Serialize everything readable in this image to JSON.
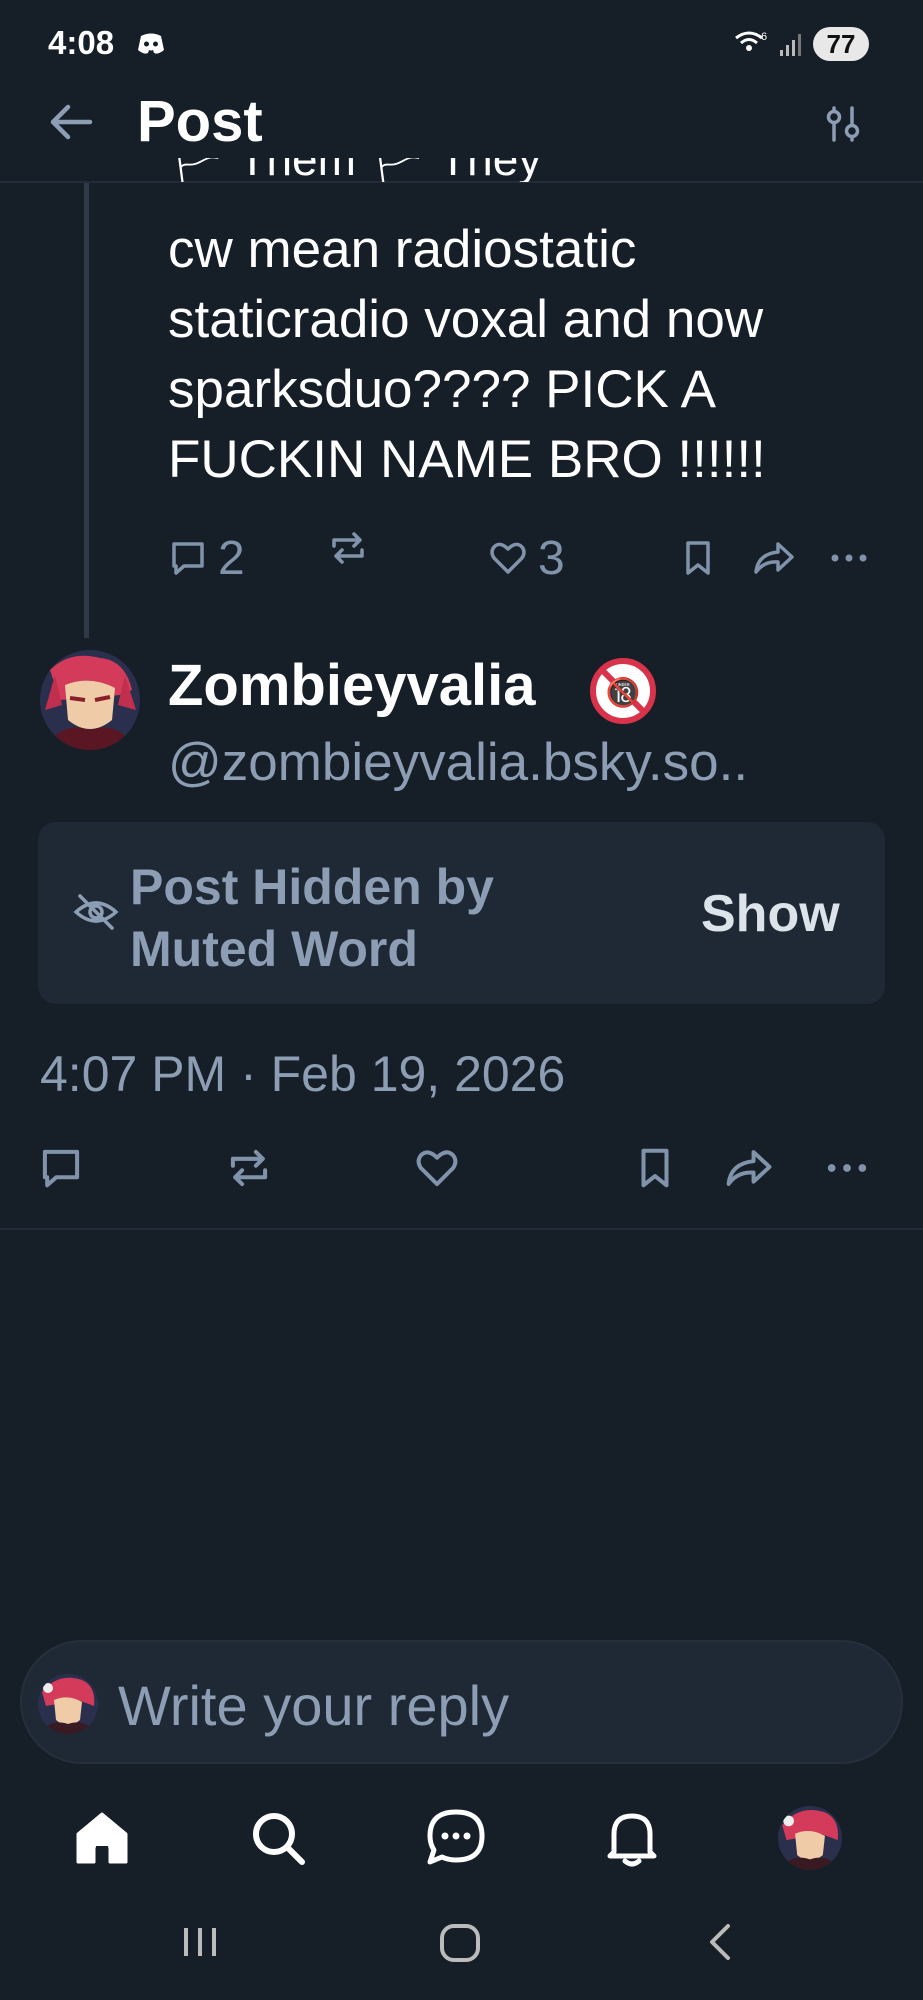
{
  "status_bar": {
    "time": "4:08",
    "battery": "77",
    "icons": [
      "discord-icon",
      "wifi-icon",
      "signal-icon"
    ]
  },
  "header": {
    "title": "Post",
    "back_icon": "back-arrow-icon",
    "filter_icon": "sliders-icon"
  },
  "parent_post": {
    "clipped_text": "🏳 Them 🏳 They",
    "text": "cw mean radiostatic\nstaticradio voxal and now\nsparksduo???? PICK A\nFUCKIN NAME BRO !!!!!!",
    "reply_count": "2",
    "like_count": "3"
  },
  "main_post": {
    "author_name": "Zombieyvalia",
    "author_handle": "@zombieyvalia.bsky.so..",
    "badge": "🔞",
    "hidden_label": "Post Hidden by\nMuted Word",
    "show_label": "Show",
    "timestamp": "4:07 PM · Feb 19, 2026"
  },
  "reply": {
    "placeholder": "Write your reply"
  },
  "bottom_nav": [
    "home-icon",
    "search-icon",
    "chat-icon",
    "notifications-icon",
    "profile-avatar"
  ],
  "colors": {
    "background": "#161e27",
    "card": "#1f2935",
    "muted_text": "#8c9db4",
    "icon": "#8193ab"
  }
}
